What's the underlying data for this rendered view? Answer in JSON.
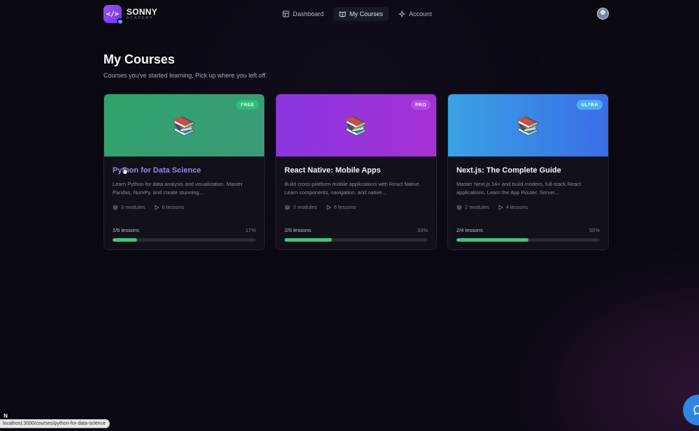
{
  "brand": {
    "name": "SONNY",
    "sub": "ACADEMY",
    "logo_symbol": "</>"
  },
  "nav": {
    "items": [
      {
        "label": "Dashboard",
        "icon": "dashboard-icon"
      },
      {
        "label": "My Courses",
        "icon": "book-icon",
        "active": true
      },
      {
        "label": "Account",
        "icon": "sparkle-icon"
      }
    ]
  },
  "page": {
    "title": "My Courses",
    "subtitle": "Courses you've started learning. Pick up where you left off."
  },
  "courses": [
    {
      "tier": "FREE",
      "title": "Python for Data Science",
      "description": "Learn Python for data analysis and visualization. Master Pandas, NumPy, and create stunning...",
      "modules": "3 modules",
      "lessons": "6 lessons",
      "progress_label": "1/6 lessons",
      "progress_pct": "17%",
      "progress": 0.17,
      "banner_color": "#2fa36b"
    },
    {
      "tier": "PRO",
      "title": "React Native: Mobile Apps",
      "description": "Build cross-platform mobile applications with React Native. Learn components, navigation, and native...",
      "modules": "3 modules",
      "lessons": "6 lessons",
      "progress_label": "2/6 lessons",
      "progress_pct": "33%",
      "progress": 0.33,
      "banner_color": "#9a34dc"
    },
    {
      "tier": "ULTRA",
      "title": "Next.js: The Complete Guide",
      "description": "Master Next.js 14+ and build modern, full-stack React applications. Learn the App Router, Server...",
      "modules": "2 modules",
      "lessons": "4 lessons",
      "progress_label": "2/4 lessons",
      "progress_pct": "50%",
      "progress": 0.5,
      "banner_color": "#3a8ae6"
    }
  ],
  "status_url": "localhost:3000/courses/python-for-data-science",
  "colors": {
    "accent": "#3cc58a",
    "hover_title": "#9a82f0",
    "background": "#0a0810"
  }
}
